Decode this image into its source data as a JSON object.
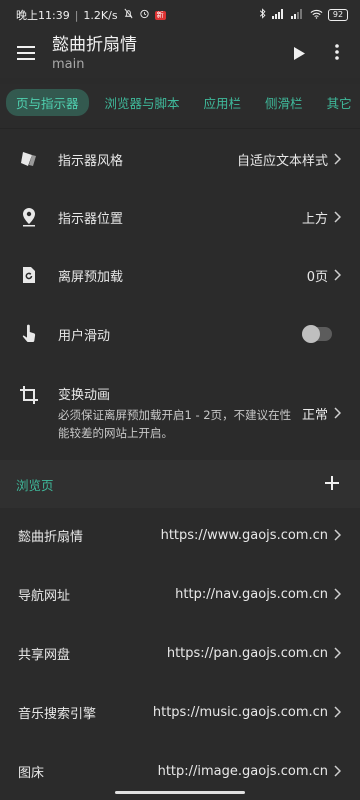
{
  "status_bar": {
    "time": "晚上11:39",
    "network_speed": "1.2K/s",
    "badge": "新",
    "battery": "92"
  },
  "app_bar": {
    "title": "懿曲折扇情",
    "subtitle": "main"
  },
  "tabs": [
    {
      "label": "页与指示器",
      "active": true
    },
    {
      "label": "浏览器与脚本",
      "active": false
    },
    {
      "label": "应用栏",
      "active": false
    },
    {
      "label": "侧滑栏",
      "active": false
    },
    {
      "label": "其它",
      "active": false
    }
  ],
  "settings": {
    "indicator_style": {
      "label": "指示器风格",
      "value": "自适应文本样式"
    },
    "indicator_position": {
      "label": "指示器位置",
      "value": "上方"
    },
    "offscreen_preload": {
      "label": "离屏预加载",
      "value": "0页"
    },
    "user_swipe": {
      "label": "用户滑动",
      "enabled": false
    },
    "transform_animation": {
      "label": "变换动画",
      "description": "必须保证离屏预加载开启1 - 2页，不建议在性能较差的网站上开启。",
      "value": "正常"
    }
  },
  "browse_section": {
    "title": "浏览页",
    "pages": [
      {
        "name": "懿曲折扇情",
        "url": "https://www.gaojs.com.cn"
      },
      {
        "name": "导航网址",
        "url": "http://nav.gaojs.com.cn"
      },
      {
        "name": "共享网盘",
        "url": "https://pan.gaojs.com.cn"
      },
      {
        "name": "音乐搜索引擎",
        "url": "https://music.gaojs.com.cn"
      },
      {
        "name": "图床",
        "url": "http://image.gaojs.com.cn"
      }
    ]
  },
  "colors": {
    "background": "#2b2b2b",
    "accent": "#3fb99b",
    "active_tab_bg": "#33594f",
    "section_bg": "#303030"
  },
  "icons": {
    "menu": "menu-icon",
    "play": "play-icon",
    "more": "more-vertical-icon",
    "style": "style-brush-icon",
    "location": "location-pin-icon",
    "preload": "refresh-page-icon",
    "touch": "touch-hand-icon",
    "crop": "crop-transform-icon",
    "add": "plus-icon",
    "chevron": "chevron-right-icon"
  }
}
